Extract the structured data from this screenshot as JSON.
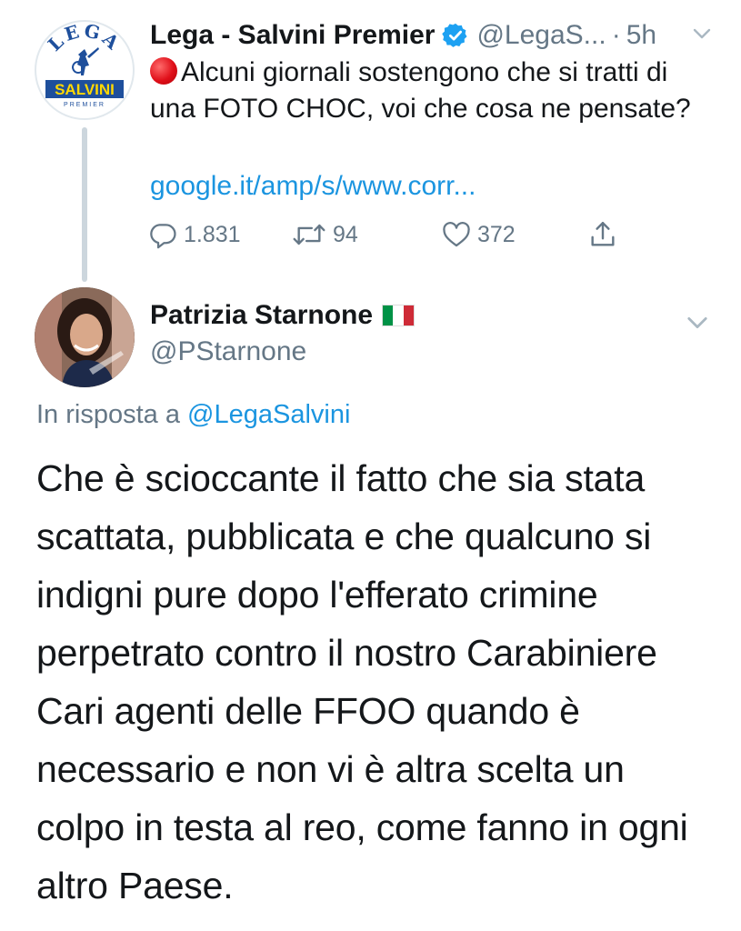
{
  "parent_tweet": {
    "author_name": "Lega - Salvini Premier",
    "handle": "@LegaS...",
    "separator": "·",
    "time": "5h",
    "avatar": {
      "ring_text": "LEGA",
      "banner_text": "SALVINI",
      "sub_text": "PREMIER"
    },
    "text": "Alcuni giornali sostengono che si tratti di una FOTO CHOC, voi che cosa ne pensate?",
    "link": "google.it/amp/s/www.corr...",
    "actions": {
      "reply_count": "1.831",
      "retweet_count": "94",
      "like_count": "372"
    },
    "icons": [
      "verified-icon",
      "red-circle-icon",
      "reply-icon",
      "retweet-icon",
      "like-icon",
      "share-icon",
      "chevron-down-icon"
    ]
  },
  "reply_tweet": {
    "author_name": "Patrizia Starnone",
    "handle": "@PStarnone",
    "flag": "italy-flag",
    "in_reply_prefix": "In risposta a",
    "in_reply_mention": "@LegaSalvini",
    "body_lines": [
      "Che è scioccante il fatto che sia stata",
      "scattata, pubblicata e che qualcuno si",
      "indigni pure dopo l'efferato crimine",
      "perpetrato contro il nostro Carabiniere",
      "Cari agenti delle FFOO quando è",
      "necessario e non vi è altra scelta un",
      "colpo in testa al reo, come fanno in ogni",
      "altro Paese."
    ]
  },
  "colors": {
    "link": "#1b95e0",
    "muted": "#657786",
    "text": "#14171a",
    "lega_blue": "#1e4f9c",
    "flag_green": "#009246",
    "flag_white": "#ffffff",
    "flag_red": "#ce2b37"
  }
}
